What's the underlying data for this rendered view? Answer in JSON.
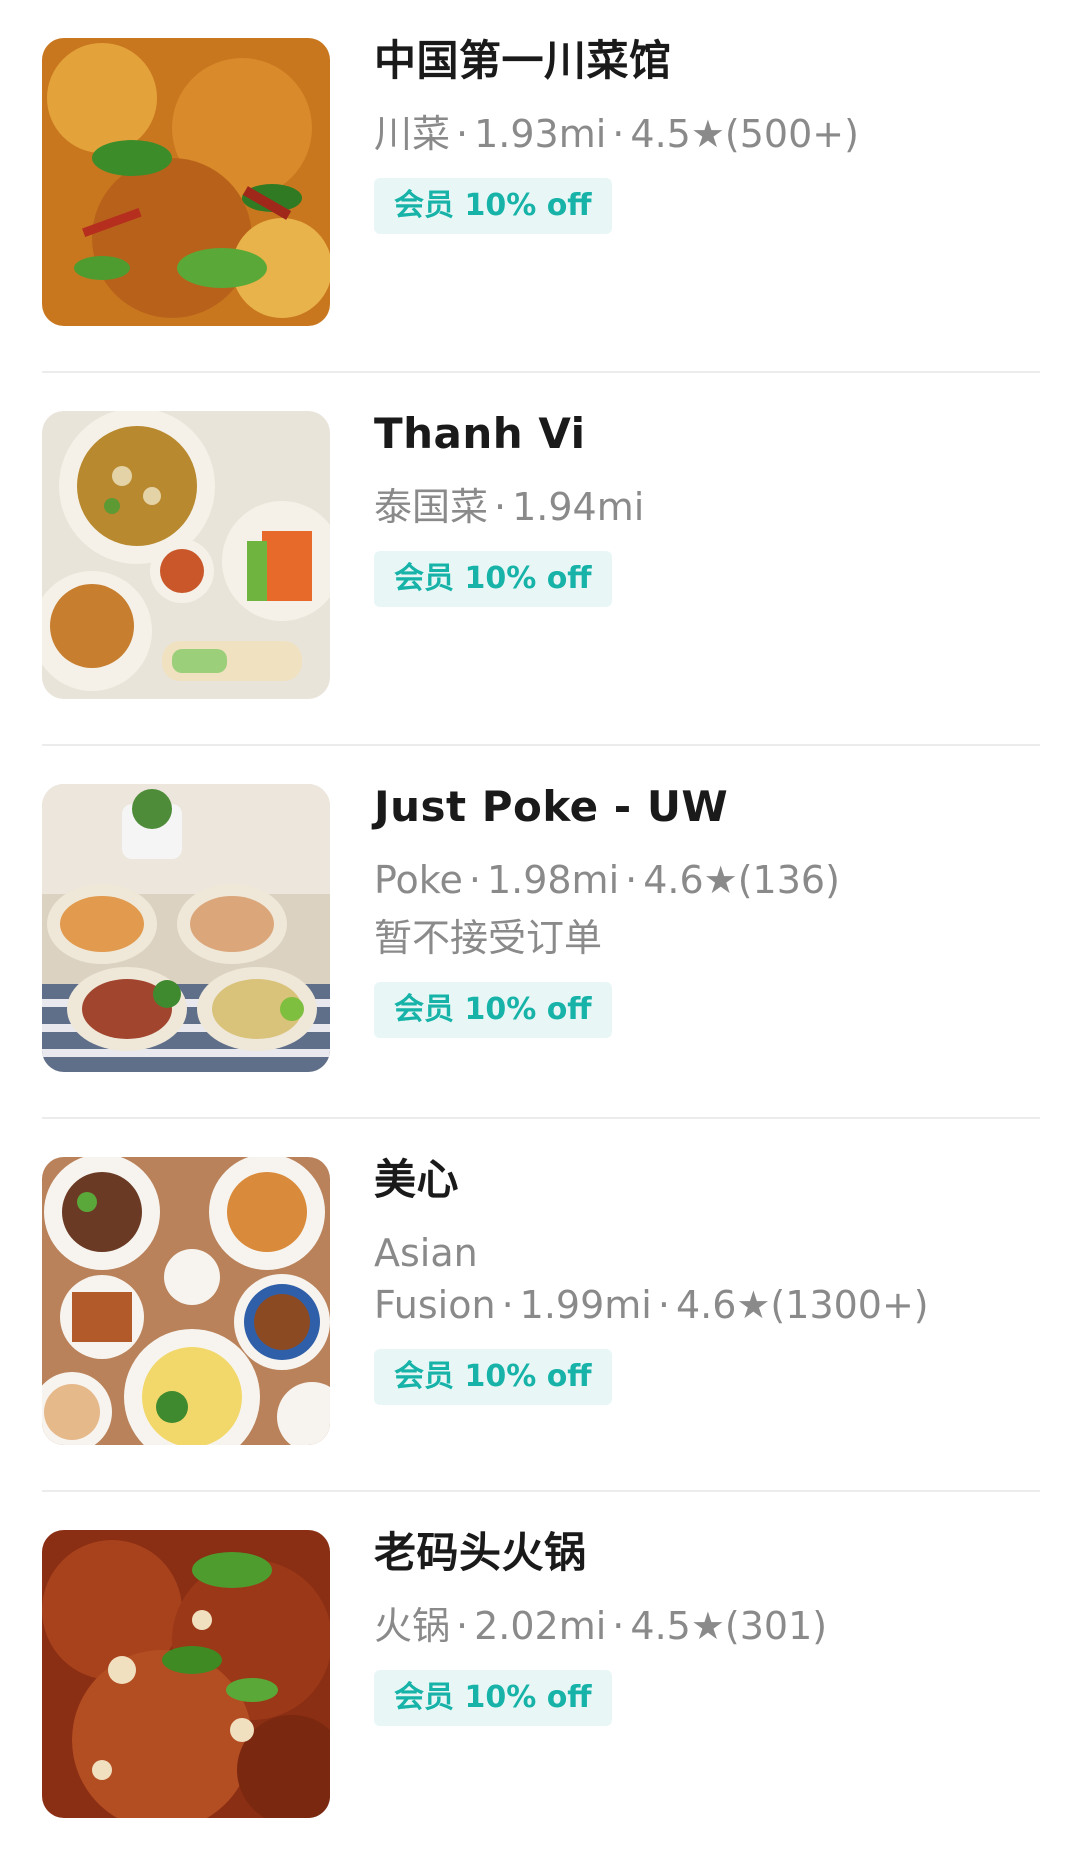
{
  "restaurants": [
    {
      "name": "中国第一川菜馆",
      "cuisine": "川菜",
      "distance": "1.93mi",
      "rating": "4.5★(500+)",
      "status": "",
      "badge": "会员 10% off",
      "image": "sichuan-dish-photo"
    },
    {
      "name": "Thanh Vi",
      "cuisine": "泰国菜",
      "distance": "1.94mi",
      "rating": "",
      "status": "",
      "badge": "会员 10% off",
      "image": "pho-spread-photo"
    },
    {
      "name": "Just Poke - UW",
      "cuisine": "Poke",
      "distance": "1.98mi",
      "rating": "4.6★(136)",
      "status": "暂不接受订单",
      "badge": "会员 10% off",
      "image": "poke-bowls-photo"
    },
    {
      "name": "美心",
      "cuisine": "Asian Fusion",
      "distance": "1.99mi",
      "rating": "4.6★(1300+)",
      "status": "",
      "badge": "会员 10% off",
      "image": "asian-fusion-plates-photo"
    },
    {
      "name": "老码头火锅",
      "cuisine": "火锅",
      "distance": "2.02mi",
      "rating": "4.5★(301)",
      "status": "",
      "badge": "会员 10% off",
      "image": "hotpot-dish-photo"
    }
  ],
  "separator": "·"
}
